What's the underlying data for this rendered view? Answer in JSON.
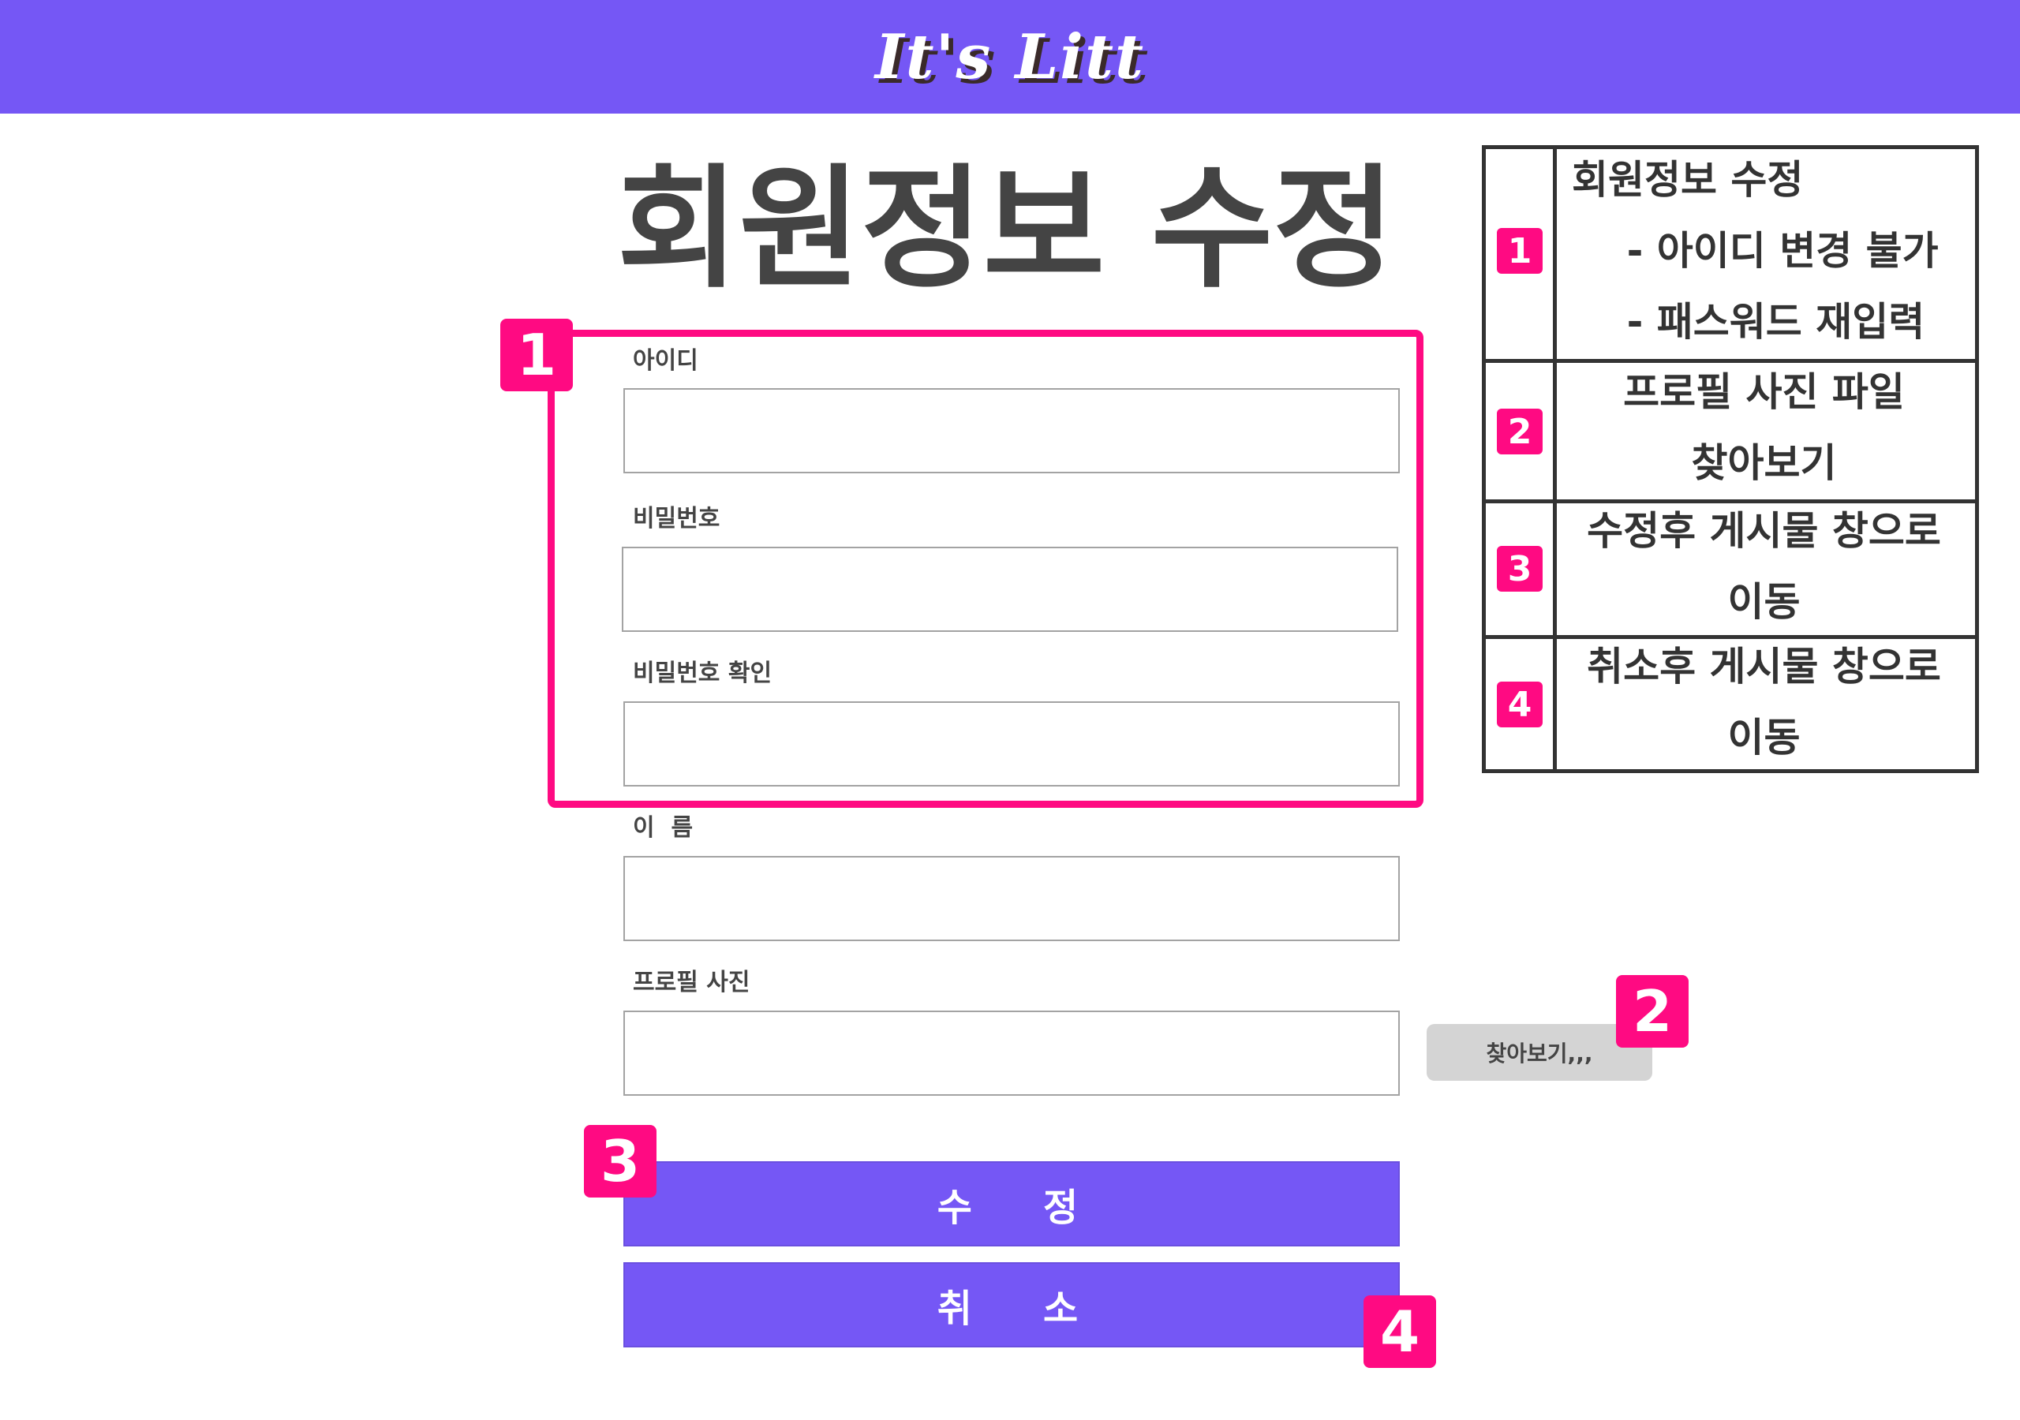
{
  "header": {
    "logo_text": "It's Litt",
    "bar_color": "#7557f5"
  },
  "page": {
    "title": "회원정보 수정"
  },
  "form": {
    "fields": [
      {
        "label": "아이디",
        "value": "",
        "placeholder": ""
      },
      {
        "label": "비밀번호",
        "value": "",
        "placeholder": ""
      },
      {
        "label": "비밀번호 확인",
        "value": "",
        "placeholder": ""
      },
      {
        "label": "이  름",
        "value": "",
        "placeholder": ""
      },
      {
        "label": "프로필 사진",
        "value": "",
        "placeholder": ""
      }
    ],
    "browse_label": "찾아보기,,,",
    "submit_label": "수   정",
    "cancel_label": "취   소"
  },
  "markers": [
    "1",
    "2",
    "3",
    "4"
  ],
  "legend": {
    "rows": [
      {
        "num": "1",
        "lines": [
          "회원정보 수정",
          "    - 아이디 변경 불가",
          "    - 패스워드 재입력"
        ]
      },
      {
        "num": "2",
        "lines": [
          "프로필 사진 파일",
          "찾아보기"
        ]
      },
      {
        "num": "3",
        "lines": [
          "수정후 게시물 창으로",
          "이동"
        ]
      },
      {
        "num": "4",
        "lines": [
          "취소후 게시물 창으로",
          "이동"
        ]
      }
    ]
  },
  "colors": {
    "accent": "#7557f5",
    "highlight": "#ff0a82",
    "text": "#444444"
  }
}
